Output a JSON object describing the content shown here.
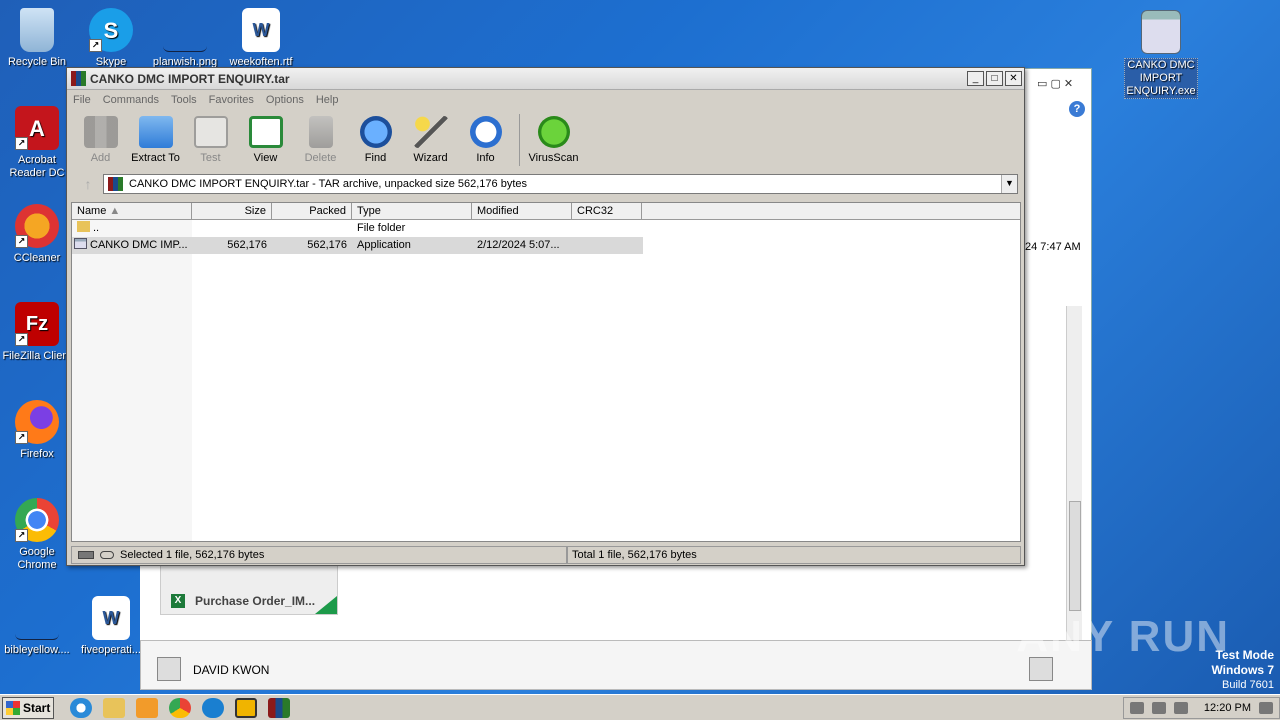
{
  "desktop": {
    "icons": [
      {
        "label": "Recycle Bin"
      },
      {
        "label": "Skype"
      },
      {
        "label": "planwish.png"
      },
      {
        "label": "weekoften.rtf"
      },
      {
        "label": "Acrobat Reader DC"
      },
      {
        "label": "CCleaner"
      },
      {
        "label": "FileZilla Client"
      },
      {
        "label": "Firefox"
      },
      {
        "label": "Google Chrome"
      },
      {
        "label": "bibleyellow...."
      },
      {
        "label": "fiveoperati..."
      },
      {
        "label": "CANKO DMC IMPORT ENQUIRY.exe"
      }
    ]
  },
  "mail": {
    "timestamp": "24 7:47 AM",
    "attachment_name": "Purchase Order_IM...",
    "sender": "DAVID KWON"
  },
  "winrar": {
    "title": "CANKO DMC IMPORT ENQUIRY.tar",
    "menu": [
      "File",
      "Commands",
      "Tools",
      "Favorites",
      "Options",
      "Help"
    ],
    "toolbar": [
      {
        "label": "Add",
        "disabled": true
      },
      {
        "label": "Extract To",
        "disabled": false
      },
      {
        "label": "Test",
        "disabled": true
      },
      {
        "label": "View",
        "disabled": false
      },
      {
        "label": "Delete",
        "disabled": true
      },
      {
        "label": "Find",
        "disabled": false
      },
      {
        "label": "Wizard",
        "disabled": false
      },
      {
        "label": "Info",
        "disabled": false
      },
      {
        "label": "VirusScan",
        "disabled": false
      }
    ],
    "path": "CANKO DMC IMPORT ENQUIRY.tar - TAR archive, unpacked size 562,176 bytes",
    "columns": [
      "Name",
      "Size",
      "Packed",
      "Type",
      "Modified",
      "CRC32"
    ],
    "rows": [
      {
        "name": "..",
        "size": "",
        "packed": "",
        "type": "File folder",
        "modified": "",
        "crc": ""
      },
      {
        "name": "CANKO DMC IMP...",
        "size": "562,176",
        "packed": "562,176",
        "type": "Application",
        "modified": "2/12/2024 5:07...",
        "crc": ""
      }
    ],
    "status_left": "Selected 1 file, 562,176 bytes",
    "status_right": "Total 1 file, 562,176 bytes"
  },
  "taskbar": {
    "start_label": "Start",
    "clock": "12:20 PM"
  },
  "watermark": {
    "brand": "ANY RUN",
    "mode": "Test Mode",
    "os": "Windows 7",
    "build": "Build 7601"
  },
  "colors": {
    "desktop_blue": "#1d6fd0",
    "window_face": "#d4d0c8",
    "selection": "#d9d9d9"
  }
}
